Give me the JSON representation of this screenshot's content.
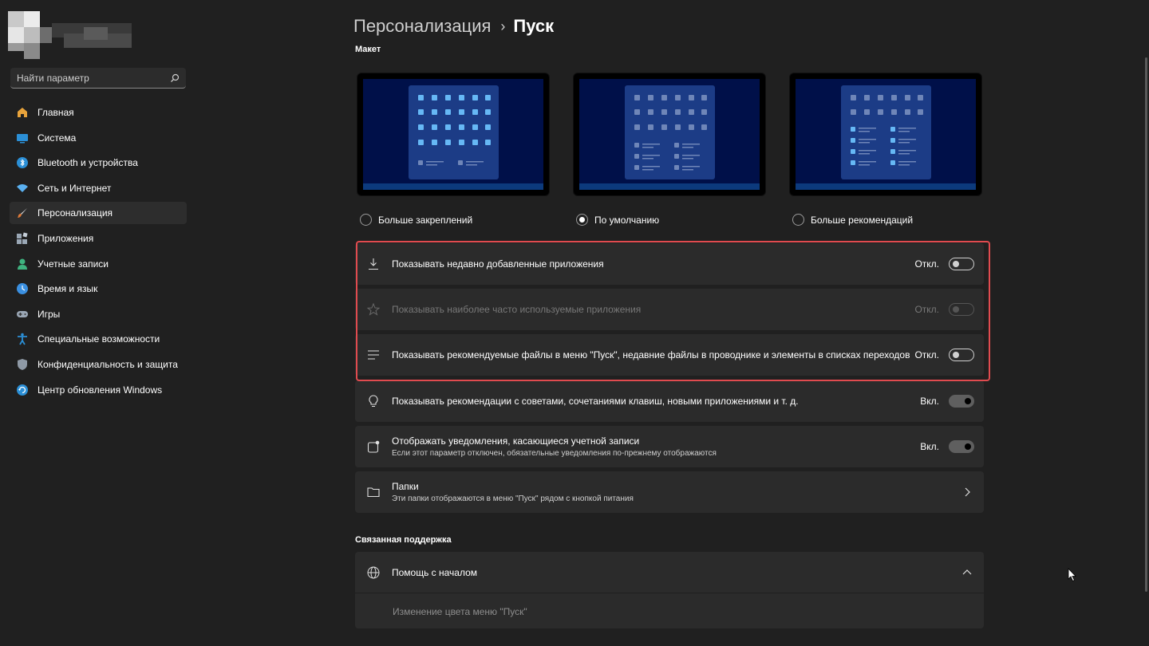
{
  "sidebar": {
    "search": {
      "placeholder": "Найти параметр",
      "icon": "search-icon"
    },
    "items": [
      {
        "label": "Главная",
        "icon": "home-icon",
        "color": "#e8a33b"
      },
      {
        "label": "Система",
        "icon": "monitor-icon",
        "color": "#2b8fd6"
      },
      {
        "label": "Bluetooth и устройства",
        "icon": "bluetooth-icon",
        "color": "#2b8fd6"
      },
      {
        "label": "Сеть и Интернет",
        "icon": "wifi-icon",
        "color": "#5ab0f0"
      },
      {
        "label": "Персонализация",
        "icon": "brush-icon",
        "color": "#e07b39",
        "active": true
      },
      {
        "label": "Приложения",
        "icon": "apps-icon",
        "color": "#9aa7b5"
      },
      {
        "label": "Учетные записи",
        "icon": "person-icon",
        "color": "#3fb27f"
      },
      {
        "label": "Время и язык",
        "icon": "globe-clock-icon",
        "color": "#3a8fe0"
      },
      {
        "label": "Игры",
        "icon": "gamepad-icon",
        "color": "#9aa7b5"
      },
      {
        "label": "Специальные возможности",
        "icon": "accessibility-icon",
        "color": "#2b8fd6"
      },
      {
        "label": "Конфиденциальность и защита",
        "icon": "shield-icon",
        "color": "#8f9aa6"
      },
      {
        "label": "Центр обновления Windows",
        "icon": "update-icon",
        "color": "#2b8fd6"
      }
    ]
  },
  "header": {
    "parent": "Персонализация",
    "separator": "›",
    "current": "Пуск"
  },
  "layout_section": {
    "title": "Макет",
    "options": [
      {
        "label": "Больше закреплений",
        "checked": false
      },
      {
        "label": "По умолчанию",
        "checked": true
      },
      {
        "label": "Больше рекомендаций",
        "checked": false
      }
    ]
  },
  "settings": [
    {
      "title": "Показывать недавно добавленные приложения",
      "state": "Откл.",
      "on": false,
      "disabled": false,
      "icon": "download-icon"
    },
    {
      "title": "Показывать наиболее часто используемые приложения",
      "state": "Откл.",
      "on": false,
      "disabled": true,
      "icon": "star-icon"
    },
    {
      "title": "Показывать рекомендуемые файлы в меню \"Пуск\", недавние файлы в проводнике и элементы в списках переходов",
      "state": "Откл.",
      "on": false,
      "disabled": false,
      "icon": "list-icon"
    },
    {
      "title": "Показывать рекомендации с советами, сочетаниями клавиш, новыми приложениями и т. д.",
      "state": "Вкл.",
      "on": true,
      "disabled": false,
      "icon": "lightbulb-icon"
    },
    {
      "title": "Отображать уведомления, касающиеся учетной записи",
      "subtitle": "Если этот параметр отключен, обязательные уведомления по-прежнему отображаются",
      "state": "Вкл.",
      "on": true,
      "disabled": false,
      "icon": "account-notification-icon"
    },
    {
      "title": "Папки",
      "subtitle": "Эти папки отображаются в меню \"Пуск\" рядом с кнопкой питания",
      "icon": "folder-icon"
    }
  ],
  "support": {
    "title": "Связанная поддержка",
    "help_title": "Помощь с началом",
    "link": "Изменение цвета меню \"Пуск\""
  },
  "colors": {
    "background": "#202020",
    "card": "#2b2b2b",
    "highlight": "#e04b4f",
    "preview_screen": "#001049",
    "preview_menu": "#1c3c86",
    "preview_tile_bright": "#66b8f5",
    "preview_tile_dim": "#6f86b8"
  }
}
